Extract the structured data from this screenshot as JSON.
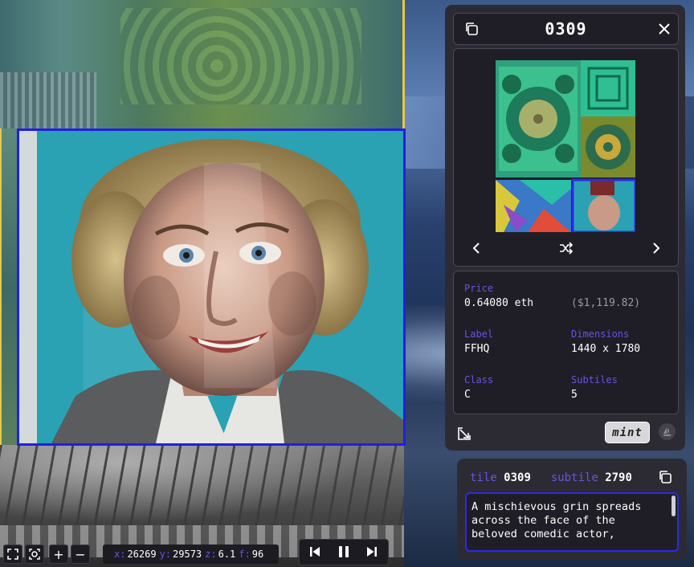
{
  "panel": {
    "title": "0309",
    "price_label": "Price",
    "price_eth": "0.64080 eth",
    "price_usd": "($1,119.82)",
    "label_label": "Label",
    "label_value": "FFHQ",
    "dimensions_label": "Dimensions",
    "dimensions_value": "1440 x 1780",
    "class_label": "Class",
    "class_value": "C",
    "subtiles_label": "Subtiles",
    "subtiles_value": "5",
    "mint_label": "mint",
    "icons": {
      "copy": "copy-icon",
      "close": "close-icon",
      "prev": "chevron-left-icon",
      "shuffle": "shuffle-icon",
      "next": "chevron-right-icon",
      "expand": "expand-icon",
      "opensea": "opensea-icon"
    }
  },
  "subtile_panel": {
    "tile_label": "tile",
    "tile_value": "0309",
    "subtile_label": "subtile",
    "subtile_value": "2790",
    "description": "A mischievous grin spreads across the face of the beloved comedic actor,"
  },
  "toolbar": {
    "x_label": "x:",
    "x_value": "26269",
    "y_label": "y:",
    "y_value": "29573",
    "z_label": "z:",
    "z_value": "6.1",
    "f_label": "f:",
    "f_value": "96",
    "zoom_in": "+",
    "zoom_out": "−",
    "icons": {
      "fullscreen": "fullscreen-icon",
      "focus": "focus-icon",
      "skip_back": "skip-back-icon",
      "pause": "pause-icon",
      "skip_forward": "skip-forward-icon"
    }
  },
  "colors": {
    "accent": "#6a52e6",
    "selection_border": "#1f1fe6",
    "panel_bg": "#2c2b33",
    "panel_inner": "#1f1e26",
    "highlight_border": "#e5c84a"
  }
}
